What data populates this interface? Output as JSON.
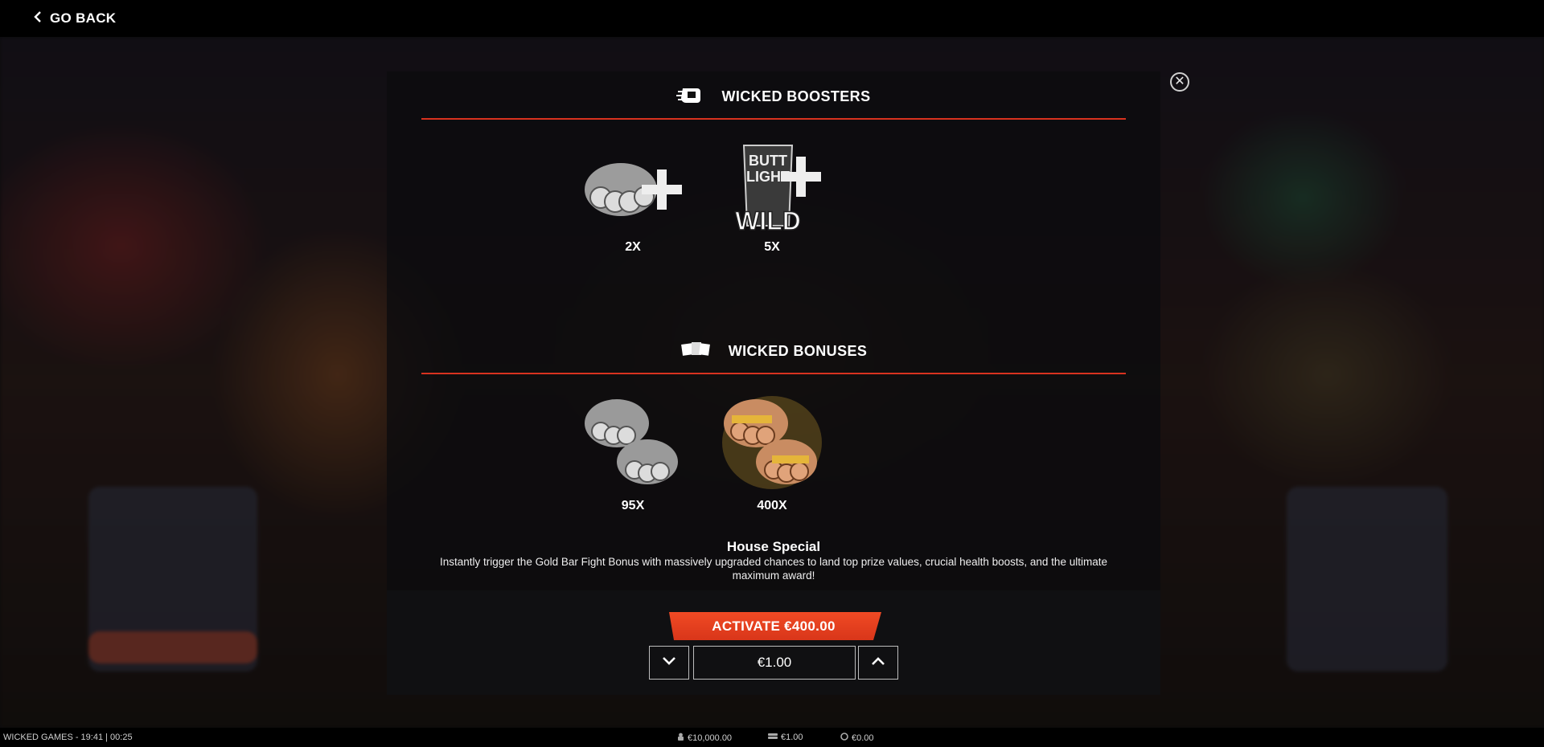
{
  "topbar": {
    "go_back_label": "GO BACK"
  },
  "boosters": {
    "title": "WICKED BOOSTERS",
    "items": [
      {
        "name": "Last Fist Plus",
        "multiplier": "2X"
      },
      {
        "name": "Butt Light Wild Plus",
        "multiplier": "5X",
        "art_text": [
          "BUTT",
          "LIGHT",
          "WILD"
        ]
      }
    ]
  },
  "bonuses": {
    "title": "WICKED BONUSES",
    "items": [
      {
        "name": "Last Call Silver",
        "multiplier": "95X"
      },
      {
        "name": "Last Call Gold",
        "multiplier": "400X"
      }
    ]
  },
  "description": {
    "title": "House Special",
    "text": "Instantly trigger the Gold Bar Fight Bonus with massively upgraded chances to land top prize values, crucial health boosts, and the ultimate maximum award!"
  },
  "actions": {
    "activate_label": "ACTIVATE €400.00",
    "stake_value": "€1.00"
  },
  "status": {
    "left": "WICKED GAMES - 19:41 | 00:25",
    "balance": "€10,000.00",
    "bet": "€1.00",
    "win": "€0.00"
  },
  "colors": {
    "accent": "#e83e1f",
    "divider": "#d8321f",
    "gold": "#d9a441",
    "silver": "#bfbfbf"
  }
}
